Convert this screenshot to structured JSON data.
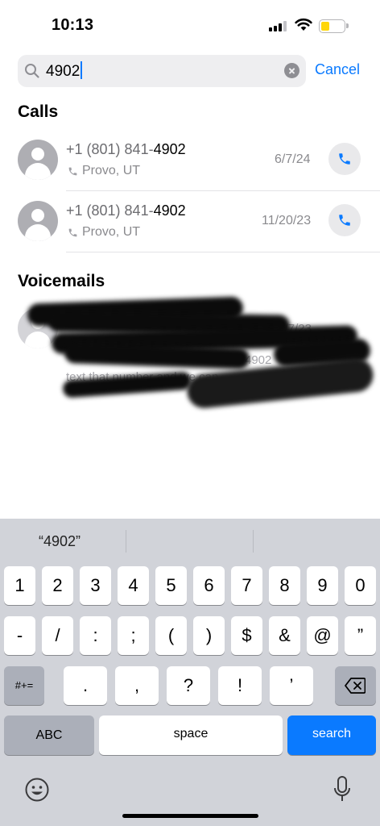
{
  "status_bar": {
    "time": "10:13"
  },
  "search": {
    "query": "4902",
    "cancel_label": "Cancel"
  },
  "sections": {
    "calls_title": "Calls",
    "voicemails_title": "Voicemails"
  },
  "calls": [
    {
      "number_prefix": "+1 (801) 841-",
      "number_match": "4902",
      "location": "Provo, UT",
      "date": "6/7/24"
    },
    {
      "number_prefix": "+1 (801) 841-",
      "number_match": "4902",
      "location": "Provo, UT",
      "date": "11/20/23"
    }
  ],
  "voicemail": {
    "date": "11/7/23",
    "visible_fragment": "4902",
    "visible_text": "text that number and we can",
    "redacted": true
  },
  "keyboard": {
    "suggestion": "“4902”",
    "row1": [
      "1",
      "2",
      "3",
      "4",
      "5",
      "6",
      "7",
      "8",
      "9",
      "0"
    ],
    "row2": [
      "-",
      "/",
      ":",
      ";",
      "(",
      ")",
      "$",
      "&",
      "@",
      "”"
    ],
    "row3": [
      ".",
      ",",
      "?",
      "!",
      "’"
    ],
    "shift_label": "#+=",
    "abc_label": "ABC",
    "space_label": "space",
    "search_label": "search"
  },
  "colors": {
    "accent": "#0a7aff",
    "keyboard_bg": "#d1d3d9"
  }
}
